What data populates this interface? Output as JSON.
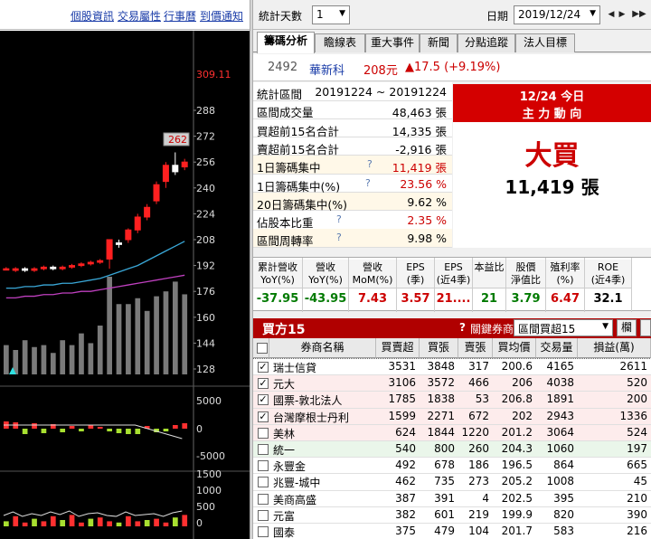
{
  "links": [
    "個股資訊",
    "交易屬性",
    "行事曆",
    "到價通知"
  ],
  "toolbar": {
    "days_label": "統計天數",
    "days_value": "1",
    "date_label": "日期",
    "date_value": "2019/12/24"
  },
  "tabs": [
    "籌碼分析",
    "瞻線表",
    "重大事件",
    "新聞",
    "分點追蹤",
    "法人目標"
  ],
  "stock": {
    "code": "2492",
    "name": "華新科",
    "price": "208元",
    "change": "▲17.5 (+9.19%)"
  },
  "stats": [
    {
      "k": "統計區間",
      "v": "20191224 ~ 20191224"
    },
    {
      "k": "區間成交量",
      "v": "48,463 張"
    },
    {
      "k": "買超前15名合計",
      "v": "14,335 張"
    },
    {
      "k": "賣超前15名合計",
      "v": "-2,916 張"
    },
    {
      "k": "1日籌碼集中",
      "v": "11,419 張"
    },
    {
      "k": "1日籌碼集中(%)",
      "v": "23.56 %"
    },
    {
      "k": "20日籌碼集中(%)",
      "v": "9.62 %"
    },
    {
      "k": "佔股本比重",
      "v": "2.35 %"
    },
    {
      "k": "區間周轉率",
      "v": "9.98 %"
    }
  ],
  "help_mark": "?",
  "signal": {
    "date": "12/24 今日",
    "title": "主 力 動 向",
    "verdict": "大買",
    "amount": "11,419 張"
  },
  "metrics": [
    {
      "h1": "累計營收",
      "h2": "YoY(%)",
      "v": "-37.95",
      "c": "#007a00"
    },
    {
      "h1": "營收",
      "h2": "YoY(%)",
      "v": "-43.95",
      "c": "#007a00"
    },
    {
      "h1": "營收",
      "h2": "MoM(%)",
      "v": "7.43",
      "c": "#cc0000"
    },
    {
      "h1": "EPS",
      "h2": "(季)",
      "v": "3.57",
      "c": "#cc0000"
    },
    {
      "h1": "EPS",
      "h2": "(近4季)",
      "v": "21....",
      "c": "#cc0000"
    },
    {
      "h1": "本益比",
      "h2": "",
      "v": "21",
      "c": "#007a00"
    },
    {
      "h1": "股價",
      "h2": "淨值比",
      "v": "3.79",
      "c": "#007a00"
    },
    {
      "h1": "殖利率",
      "h2": "(%)",
      "v": "6.47",
      "c": "#cc0000"
    },
    {
      "h1": "ROE",
      "h2": "(近4季)",
      "v": "32.1",
      "c": "#000000"
    }
  ],
  "buy": {
    "title": "買方15",
    "keyword_label": "關鍵券商:",
    "keyword_value": "區間買超15",
    "col_btn": "欄"
  },
  "table_headers": [
    "券商名稱",
    "買賣超",
    "買張",
    "賣張",
    "買均價",
    "交易量",
    "損益(萬)"
  ],
  "rows": [
    {
      "chk": true,
      "name": "瑞士信貸",
      "v": [
        "3531",
        "3848",
        "317",
        "200.6",
        "4165",
        "2611"
      ],
      "bg": "sel"
    },
    {
      "chk": true,
      "name": "元大",
      "v": [
        "3106",
        "3572",
        "466",
        "206",
        "4038",
        "520"
      ],
      "bg": "pink"
    },
    {
      "chk": true,
      "name": "國票-敦北法人",
      "v": [
        "1785",
        "1838",
        "53",
        "206.8",
        "1891",
        "200"
      ],
      "bg": "pink"
    },
    {
      "chk": true,
      "name": "台灣摩根士丹利",
      "v": [
        "1599",
        "2271",
        "672",
        "202",
        "2943",
        "1336"
      ],
      "bg": "pink"
    },
    {
      "chk": false,
      "name": "美林",
      "v": [
        "624",
        "1844",
        "1220",
        "201.2",
        "3064",
        "524"
      ],
      "bg": "pink"
    },
    {
      "chk": false,
      "name": "統一",
      "v": [
        "540",
        "800",
        "260",
        "204.3",
        "1060",
        "197"
      ],
      "bg": "green"
    },
    {
      "chk": false,
      "name": "永豐金",
      "v": [
        "492",
        "678",
        "186",
        "196.5",
        "864",
        "665"
      ],
      "bg": ""
    },
    {
      "chk": false,
      "name": "兆豐-城中",
      "v": [
        "462",
        "735",
        "273",
        "205.2",
        "1008",
        "45"
      ],
      "bg": ""
    },
    {
      "chk": false,
      "name": "美商高盛",
      "v": [
        "387",
        "391",
        "4",
        "202.5",
        "395",
        "210"
      ],
      "bg": ""
    },
    {
      "chk": false,
      "name": "元富",
      "v": [
        "382",
        "601",
        "219",
        "199.9",
        "820",
        "390"
      ],
      "bg": ""
    },
    {
      "chk": false,
      "name": "國泰",
      "v": [
        "375",
        "479",
        "104",
        "201.7",
        "583",
        "216"
      ],
      "bg": ""
    }
  ],
  "chart_data": {
    "type": "candlestick",
    "price_ticks": [
      "309.11",
      "288",
      "272",
      "256",
      "240",
      "224",
      "208",
      "192",
      "176",
      "160",
      "144",
      "128"
    ],
    "max_label": "309.11",
    "peak_label": "262",
    "macd_ticks": [
      "5000",
      "0",
      "-5000"
    ],
    "osc_ticks": [
      "1500",
      "1000",
      "500",
      "0"
    ],
    "candles": [
      {
        "o": 190,
        "c": 190,
        "h": 191,
        "l": 189
      },
      {
        "o": 189,
        "c": 190,
        "h": 191,
        "l": 188
      },
      {
        "o": 190,
        "c": 189,
        "h": 191,
        "l": 188
      },
      {
        "o": 189,
        "c": 190,
        "h": 191,
        "l": 188
      },
      {
        "o": 190,
        "c": 191,
        "h": 192,
        "l": 189
      },
      {
        "o": 191,
        "c": 190,
        "h": 192,
        "l": 189
      },
      {
        "o": 190,
        "c": 191,
        "h": 192,
        "l": 189
      },
      {
        "o": 191,
        "c": 192,
        "h": 193,
        "l": 190
      },
      {
        "o": 192,
        "c": 193,
        "h": 194,
        "l": 191
      },
      {
        "o": 193,
        "c": 194,
        "h": 195,
        "l": 192
      },
      {
        "o": 194,
        "c": 195,
        "h": 196,
        "l": 193
      },
      {
        "o": 196,
        "c": 208,
        "h": 208,
        "l": 190
      },
      {
        "o": 206,
        "c": 205,
        "h": 208,
        "l": 203
      },
      {
        "o": 208,
        "c": 214,
        "h": 215,
        "l": 206
      },
      {
        "o": 214,
        "c": 222,
        "h": 224,
        "l": 212
      },
      {
        "o": 222,
        "c": 228,
        "h": 230,
        "l": 220
      },
      {
        "o": 232,
        "c": 242,
        "h": 244,
        "l": 230
      },
      {
        "o": 244,
        "c": 254,
        "h": 256,
        "l": 240
      },
      {
        "o": 254,
        "c": 250,
        "h": 262,
        "l": 248
      },
      {
        "o": 253,
        "c": 256,
        "h": 258,
        "l": 251
      }
    ],
    "volumes": [
      0.3,
      0.25,
      0.35,
      0.28,
      0.3,
      0.22,
      0.35,
      0.3,
      0.42,
      0.32,
      0.5,
      1.0,
      0.72,
      0.72,
      0.78,
      0.65,
      0.8,
      0.85,
      0.95,
      0.82
    ],
    "macd": [
      0.8,
      0.7,
      -0.6,
      0.6,
      -0.5,
      0.5,
      -0.4,
      0.3,
      -0.3,
      0.4,
      0.2,
      -0.3,
      -0.5,
      -0.6,
      -0.6,
      0.3,
      -0.4,
      -0.3,
      0.4,
      0.6
    ],
    "osc": [
      0.4,
      0.8,
      0.3,
      0.6,
      0.4,
      0.8,
      0.5,
      0.9,
      0.3,
      0.6,
      0.7,
      0.4,
      0.3,
      0.8,
      0.4,
      0.5,
      0.6,
      0.3,
      0.7,
      0.9
    ],
    "ma1": [
      178,
      178,
      179,
      179,
      180,
      180,
      181,
      181,
      182,
      183,
      184,
      186,
      188,
      190,
      192,
      195,
      198,
      201,
      204,
      207
    ],
    "ma2": [
      172,
      172,
      173,
      173,
      174,
      174,
      175,
      175,
      176,
      176,
      177,
      178,
      179,
      180,
      181,
      182,
      183,
      184,
      185,
      186
    ]
  }
}
